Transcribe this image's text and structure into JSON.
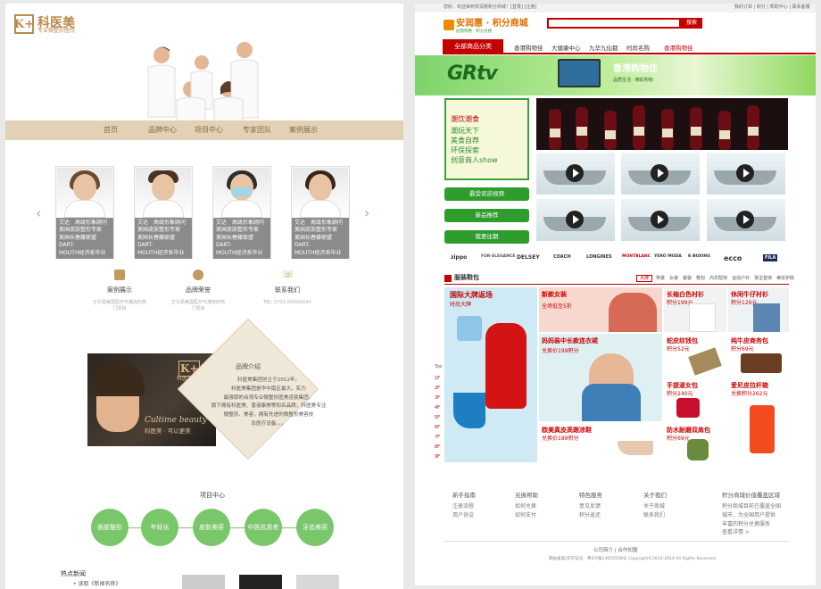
{
  "left": {
    "logo_mark": "K+",
    "logo_text": "科医美",
    "logo_sub": "专业微整形医院",
    "nav": [
      "首页",
      "品牌中心",
      "项目中心",
      "专家团队",
      "案例展示"
    ],
    "doctors": [
      {
        "name": "艾达",
        "title": "高级形象顾问",
        "lines": [
          "美国皮肤整形专家",
          "美国长春藤联盟DART-",
          "MOUTH经济系毕业"
        ]
      },
      {
        "name": "艾达",
        "title": "高级形象顾问",
        "lines": [
          "美国皮肤整形专家",
          "美国长春藤联盟DART-",
          "MOUTH经济系毕业"
        ]
      },
      {
        "name": "艾达",
        "title": "高级形象顾问",
        "lines": [
          "美国皮肤整形专家",
          "美国长春藤联盟DART-",
          "MOUTH经济系毕业"
        ]
      },
      {
        "name": "艾达",
        "title": "高级形象顾问",
        "lines": [
          "美国皮肤整形专家",
          "美国长春藤联盟DART-",
          "MOUTH经济系毕业"
        ]
      }
    ],
    "services": [
      {
        "name": "案例展示",
        "desc": "正引领美国医疗与潮流的热门项目",
        "icon": "document-icon"
      },
      {
        "name": "品牌荣誉",
        "desc": "正引领美国医疗与潮流的热门项目",
        "icon": "badge-icon"
      },
      {
        "name": "联系我们",
        "desc": "TEL: 0731-XXXXXXXX",
        "icon": "phone-icon"
      }
    ],
    "brand_intro_title": "品牌介绍",
    "brand_intro_text": [
      "科医美集团创立于2012年，",
      "科医美集团是华中南区最大，实力",
      "最强厚的台湾专业微整形医美连锁集团，",
      "旗下拥有科医美、香港康美等知名品牌，科医美专注",
      "微整形、美容，拥有先进的微整形美容技",
      "及医疗设备。。。"
    ],
    "ad_logo": "科医美",
    "ad_script": "Cultime beauty",
    "ad_tagline": "科医美 · 可以更美",
    "project_title": "项目中心",
    "projects": [
      "面部整形",
      "年轻化",
      "皮肤美容",
      "中医抗衰老",
      "牙齿美容"
    ],
    "hot_news_title": "热点新闻",
    "hot_news_item": "• 读取《新闻名称》"
  },
  "right": {
    "topbar": "您好，欢迎来到安润惠积分商城！[登录] [注册]",
    "toplinks": "我的订单 | 积分 | 帮助中心 | 联系客服",
    "logo": "安润惠 · 积分商城",
    "logo_sub": "促销特惠 · 积分兑换",
    "search_btn": "搜索",
    "search_placeholder": "",
    "nav_first": "全部商品分类",
    "nav": [
      "香港购物佳",
      "大健康中心",
      "九华九仙都",
      "时尚名购",
      "香港购物佳"
    ],
    "banner_logo": "GRtv",
    "banner_title": "香港购物佳",
    "banner_sub": "品质生活 · 精彩购物",
    "promo_links": [
      "潮饮潮食",
      "潮玩天下",
      "美食自荐",
      "环保探索",
      "创意商人show"
    ],
    "green_buttons": [
      "最受欢迎视频",
      "新品推荐",
      "我要往期"
    ],
    "brands": [
      "zippo",
      "FOR·ELEGANCE",
      "DELSEY",
      "COACH",
      "LONGINES",
      "MONTBLANC",
      "YERO MODA",
      "K·BOXING",
      "ecco",
      "FILA"
    ],
    "section_title": "服装鞋包",
    "section_tabs": [
      "大牌",
      "男装",
      "女装",
      "童装",
      "鞋包",
      "内衣配饰",
      "运动户外",
      "珠宝首饰",
      "美妆护肤"
    ],
    "tile_big": "国际大牌返场",
    "tile_big_sub": "时尚大牌",
    "tiles": [
      {
        "title": "新款女装",
        "price": "全场低至5折"
      },
      {
        "title": "长袖白色衬衫",
        "price": "积分199元"
      },
      {
        "title": "休闲牛仔衬衫",
        "price": "积分129元"
      },
      {
        "title": "妈妈装中长款连衣裙",
        "price": "兑换价199积分"
      },
      {
        "title": "蛇皮纹钱包",
        "price": "积分52元"
      },
      {
        "title": "纯牛皮商务包",
        "price": "积分69元"
      },
      {
        "title": "手提淑女包",
        "price": "积分240元"
      },
      {
        "title": "爱尼皮拉杆箱",
        "price": "兑换积分262元"
      },
      {
        "title": "欧美真皮高跟凉鞋",
        "price": "兑换价189积分"
      },
      {
        "title": "防水耐磨双肩包",
        "price": "积分69元"
      }
    ],
    "top_label": "Top",
    "rank_nums": [
      "1F",
      "2F",
      "3F",
      "4F",
      "5F",
      "6F",
      "7F",
      "8F",
      "9F"
    ],
    "footer_cols": [
      {
        "title": "新手指南",
        "items": [
          "注册流程",
          "用户协议"
        ]
      },
      {
        "title": "兑换帮助",
        "items": [
          "如何兑换",
          "如何支付"
        ]
      },
      {
        "title": "特色服务",
        "items": [
          "意见反馈",
          "积分返还"
        ]
      },
      {
        "title": "关于我们",
        "items": [
          "关于商城",
          "联系我们"
        ]
      },
      {
        "title": "积分商城价值覆盖区域",
        "items": [
          "积分商城目前已覆盖全国",
          "城市，为全国用户提供",
          "丰富的积分兑换服务",
          "查看详情 >"
        ]
      }
    ],
    "footer_links": "公司简介   |   合作加盟",
    "copyright": "网站备案/许可证号：粤ICP备14055558号  Copyright©2013-2014 All Rights Reserved"
  }
}
